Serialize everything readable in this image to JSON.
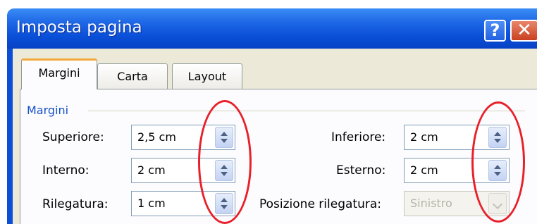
{
  "window": {
    "title": "Imposta pagina",
    "help_glyph": "?",
    "close_glyph": "✕"
  },
  "tabs": [
    {
      "label": "Margini",
      "active": true
    },
    {
      "label": "Carta",
      "active": false
    },
    {
      "label": "Layout",
      "active": false
    }
  ],
  "margins": {
    "section_title": "Margini",
    "superiore": {
      "label": "Superiore:",
      "value": "2,5 cm"
    },
    "interno": {
      "label": "Interno:",
      "value": "2 cm"
    },
    "rilegatura": {
      "label": "Rilegatura:",
      "value": "1 cm"
    },
    "inferiore": {
      "label": "Inferiore:",
      "value": "2 cm"
    },
    "esterno": {
      "label": "Esterno:",
      "value": "2 cm"
    },
    "posizione_rilegatura": {
      "label": "Posizione rilegatura:",
      "value": "Sinistro",
      "enabled": false
    }
  },
  "colors": {
    "titlebar": "#0a4fd8",
    "annotation": "#e8202a",
    "section_title": "#1550c8",
    "active_tab_accent": "#f2a93b"
  },
  "icons": {
    "help": "question-mark-icon",
    "close": "close-x-icon",
    "spin": "spin-up-down-icon",
    "dropdown": "chevron-down-icon"
  }
}
